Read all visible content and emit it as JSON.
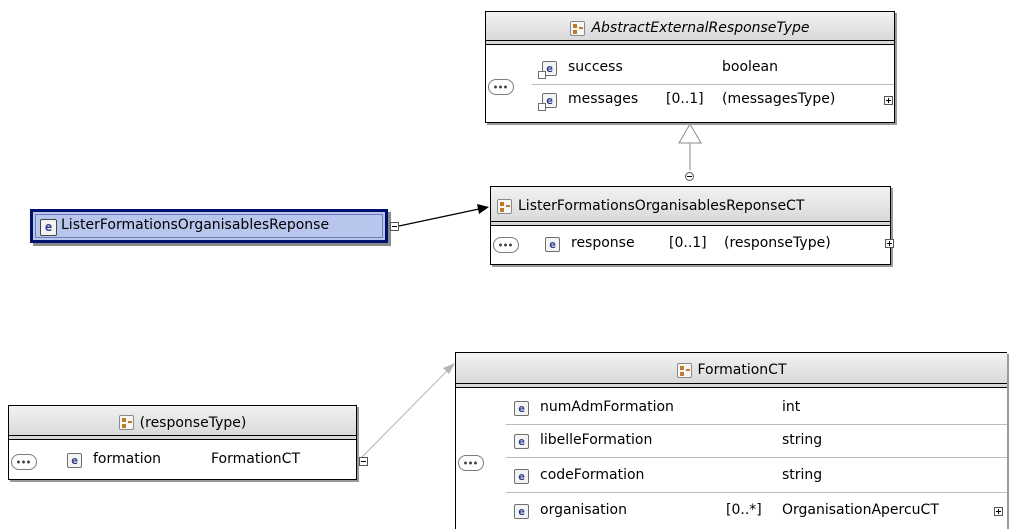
{
  "root_element": {
    "name": "ListerFormationsOrganisablesReponse"
  },
  "abstract_type": {
    "name": "AbstractExternalResponseType",
    "fields": [
      {
        "name": "success",
        "occurs": "",
        "type": "boolean"
      },
      {
        "name": "messages",
        "occurs": "[0..1]",
        "type": "(messagesType)"
      }
    ]
  },
  "reponse_type": {
    "name": "ListerFormationsOrganisablesReponseCT",
    "fields": [
      {
        "name": "response",
        "occurs": "[0..1]",
        "type": "(responseType)"
      }
    ]
  },
  "response_type": {
    "name": "(responseType)",
    "fields": [
      {
        "name": "formation",
        "occurs": "",
        "type": "FormationCT"
      }
    ]
  },
  "formation_type": {
    "name": "FormationCT",
    "fields": [
      {
        "name": "numAdmFormation",
        "occurs": "",
        "type": "int"
      },
      {
        "name": "libelleFormation",
        "occurs": "",
        "type": "string"
      },
      {
        "name": "codeFormation",
        "occurs": "",
        "type": "string"
      },
      {
        "name": "organisation",
        "occurs": "[0..*]",
        "type": "OrganisationApercuCT"
      }
    ]
  },
  "icons": {
    "element": "e",
    "complex_type": "complex-type-icon",
    "sequence": "sequence-compositor-icon"
  },
  "colors": {
    "root_fill": "#b8c6ee",
    "root_border": "#00106e",
    "element_letter": "#2d3c8c",
    "type_icon": "#c07a2a"
  }
}
